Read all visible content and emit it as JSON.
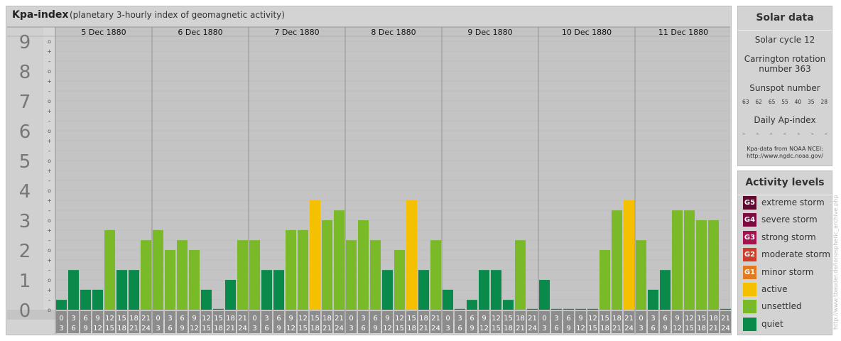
{
  "header": {
    "title": "Kpa-index",
    "subtitle": "(planetary 3-hourly index of geomagnetic activity)"
  },
  "chart_data": {
    "type": "bar",
    "days": [
      "5 Dec 1880",
      "6 Dec 1880",
      "7 Dec 1880",
      "8 Dec 1880",
      "9 Dec 1880",
      "10 Dec 1880",
      "11 Dec 1880"
    ],
    "interval_start_labels": [
      "0",
      "3",
      "6",
      "9",
      "12",
      "15",
      "18",
      "21"
    ],
    "interval_end_labels": [
      "3",
      "6",
      "9",
      "12",
      "15",
      "18",
      "21",
      "24"
    ],
    "y_ticks": [
      "0",
      "1",
      "2",
      "3",
      "4",
      "5",
      "6",
      "7",
      "8",
      "9"
    ],
    "minor_tick_labels": [
      "+",
      "o",
      "–"
    ],
    "ylim": [
      0,
      9.33
    ],
    "values": [
      [
        0.33,
        1.33,
        0.67,
        0.67,
        2.67,
        1.33,
        1.33,
        2.33
      ],
      [
        2.67,
        2.0,
        2.33,
        2.0,
        0.67,
        0.0,
        1.0,
        2.33
      ],
      [
        2.33,
        1.33,
        1.33,
        2.67,
        2.67,
        3.67,
        3.0,
        3.33
      ],
      [
        2.33,
        3.0,
        2.33,
        1.33,
        2.0,
        3.67,
        1.33,
        2.33
      ],
      [
        0.67,
        0.0,
        0.33,
        1.33,
        1.33,
        0.33,
        2.33,
        0.0
      ],
      [
        1.0,
        0.0,
        0.0,
        0.0,
        0.0,
        2.0,
        3.33,
        3.67
      ],
      [
        2.33,
        0.67,
        1.33,
        3.33,
        3.33,
        3.0,
        3.0,
        0.0
      ]
    ],
    "color_thresholds": {
      "quiet": "Kp < 2-",
      "unsettled": "2- to 3+",
      "active": "4- to 4+"
    }
  },
  "solar": {
    "title": "Solar data",
    "cycle": "Solar cycle 12",
    "carrington_line1": "Carrington rotation",
    "carrington_line2": "number 363",
    "sunspot_title": "Sunspot number",
    "sunspot_values": [
      "63",
      "62",
      "65",
      "55",
      "40",
      "35",
      "28"
    ],
    "ap_title": "Daily Ap-index",
    "ap_values": [
      "–",
      "–",
      "–",
      "–",
      "–",
      "–",
      "–"
    ],
    "credit_line1": "Kpa-data from NOAA NCEI:",
    "credit_line2": "http://www.ngdc.noaa.gov/"
  },
  "levels": {
    "title": "Activity levels",
    "items": [
      {
        "badge": "G5",
        "label": "extreme storm",
        "color": "#5c0a2d"
      },
      {
        "badge": "G4",
        "label": "severe storm",
        "color": "#7a0a40"
      },
      {
        "badge": "G3",
        "label": "strong storm",
        "color": "#a8114f"
      },
      {
        "badge": "G2",
        "label": "moderate storm",
        "color": "#d03c2a"
      },
      {
        "badge": "G1",
        "label": "minor storm",
        "color": "#e07b22"
      },
      {
        "badge": "",
        "label": "active",
        "color": "#f5c000"
      },
      {
        "badge": "",
        "label": "unsettled",
        "color": "#7aba28"
      },
      {
        "badge": "",
        "label": "quiet",
        "color": "#0a8a4a"
      }
    ]
  },
  "colors": {
    "quiet": "#0a8a4a",
    "unsettled": "#7aba28",
    "active": "#f5c000",
    "band_dark": "#c4c4c4",
    "band_light": "#e4e4e4",
    "axis_number": "#777777",
    "interval_label_bg": "#8c8c8c"
  },
  "watermark": "http://www.tbauder.de/ionospheric_archive.php"
}
